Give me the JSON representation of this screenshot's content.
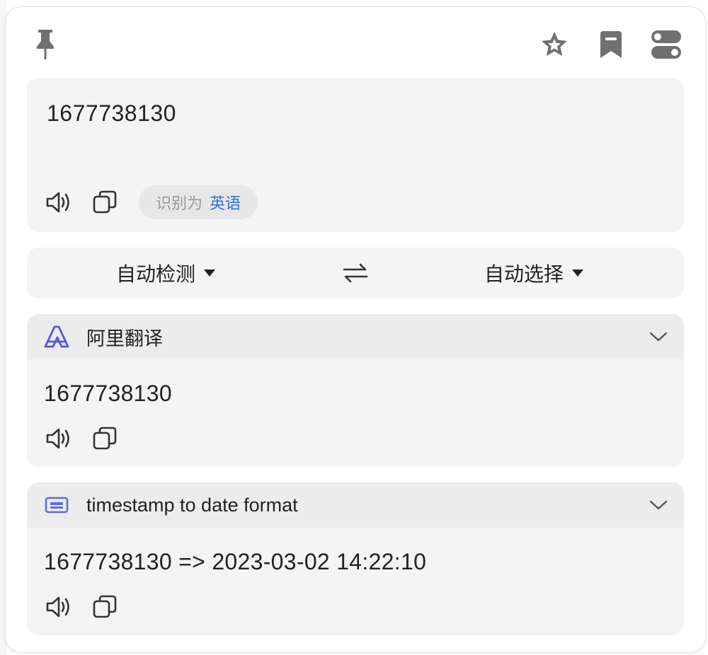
{
  "toolbar": {
    "pin_icon": "pin-icon",
    "favorite_icon": "star-icon",
    "bookmark_icon": "bookmark-icon",
    "settings_icon": "toggle-icon"
  },
  "source": {
    "text": "1677738130",
    "detected_prefix": "识别为",
    "detected_language": "英语"
  },
  "languages": {
    "from": "自动检测",
    "to": "自动选择",
    "swap_icon": "swap-arrows-icon"
  },
  "results": [
    {
      "service": "阿里翻译",
      "icon": "aliyun-icon",
      "text": "1677738130"
    },
    {
      "service": "timestamp to date format",
      "icon": "keyboard-icon",
      "text": "1677738130 => 2023-03-02 14:22:10"
    }
  ],
  "colors": {
    "accent": "#2f6fe8",
    "panel": "#f4f4f4",
    "header": "#ececec",
    "ali_icon": "#5b56d6",
    "keyboard_icon": "#5b6fd6"
  }
}
